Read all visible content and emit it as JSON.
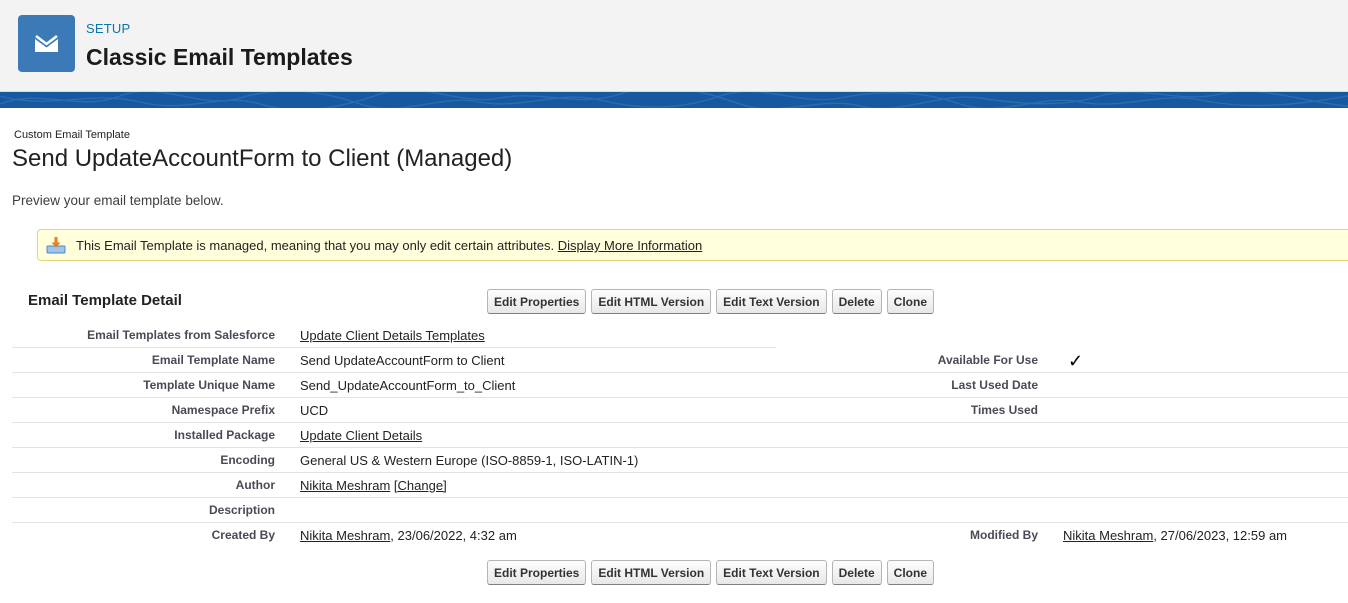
{
  "header": {
    "section_label": "SETUP",
    "title": "Classic Email Templates",
    "icon": "envelope-icon"
  },
  "page": {
    "type_label": "Custom Email Template",
    "title": "Send UpdateAccountForm to Client (Managed)",
    "description": "Preview your email template below."
  },
  "banner": {
    "text": "This Email Template is managed, meaning that you may only edit certain attributes.",
    "link": "Display More Information",
    "icon": "download-icon"
  },
  "detail": {
    "section_title": "Email Template Detail",
    "buttons": {
      "edit_properties": "Edit Properties",
      "edit_html": "Edit HTML Version",
      "edit_text": "Edit Text Version",
      "delete": "Delete",
      "clone": "Clone"
    },
    "fields": {
      "folder": {
        "label": "Email Templates from Salesforce",
        "value": "Update Client Details Templates"
      },
      "name": {
        "label": "Email Template Name",
        "value": "Send UpdateAccountForm to Client"
      },
      "unique_name": {
        "label": "Template Unique Name",
        "value": "Send_UpdateAccountForm_to_Client"
      },
      "namespace": {
        "label": "Namespace Prefix",
        "value": "UCD"
      },
      "package": {
        "label": "Installed Package",
        "value": "Update Client Details"
      },
      "encoding": {
        "label": "Encoding",
        "value": "General US & Western Europe (ISO-8859-1, ISO-LATIN-1)"
      },
      "author": {
        "label": "Author",
        "value": "Nikita Meshram",
        "change": "[Change]"
      },
      "description": {
        "label": "Description",
        "value": ""
      },
      "created_by": {
        "label": "Created By",
        "user": "Nikita Meshram",
        "date": ", 23/06/2022, 4:32 am"
      },
      "available": {
        "label": "Available For Use",
        "checked": true,
        "mark": "✓"
      },
      "last_used": {
        "label": "Last Used Date",
        "value": ""
      },
      "times_used": {
        "label": "Times Used",
        "value": ""
      },
      "modified_by": {
        "label": "Modified By",
        "user": "Nikita Meshram",
        "date": ", 27/06/2023, 12:59 am"
      }
    }
  }
}
